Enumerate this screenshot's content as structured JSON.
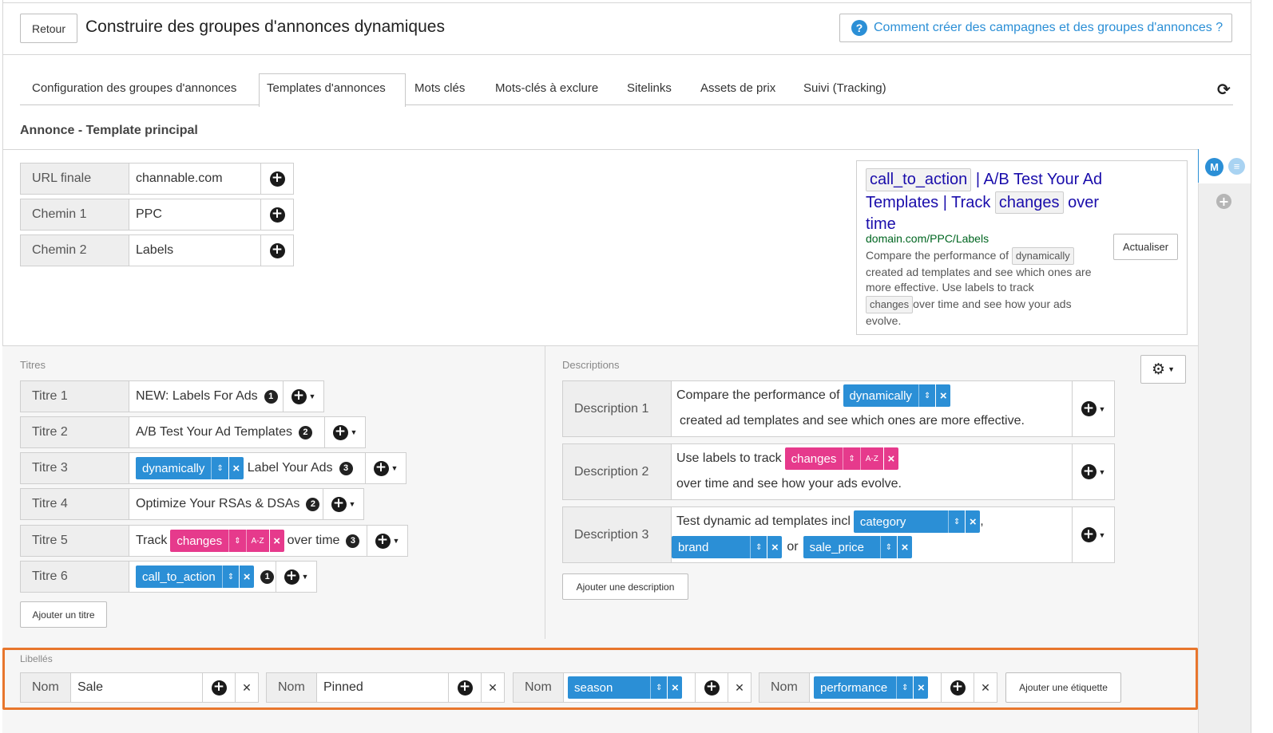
{
  "header": {
    "back_label": "Retour",
    "title": "Construire des groupes d'annonces dynamiques",
    "help_label": "Comment créer des campagnes et des groupes d'annonces ?",
    "help_icon": "?"
  },
  "tabs": [
    {
      "label": "Configuration des groupes d'annonces"
    },
    {
      "label": "Templates d'annonces",
      "active": true
    },
    {
      "label": "Mots clés"
    },
    {
      "label": "Mots-clés à exclure"
    },
    {
      "label": "Sitelinks"
    },
    {
      "label": "Assets de prix"
    },
    {
      "label": "Suivi (Tracking)"
    }
  ],
  "section_title": "Annonce - Template principal",
  "url_fields": [
    {
      "label": "URL finale",
      "value": "channable.com"
    },
    {
      "label": "Chemin 1",
      "value": "PPC"
    },
    {
      "label": "Chemin 2",
      "value": "Labels"
    }
  ],
  "preview": {
    "headline_tag1": "call_to_action",
    "headline_part1": "| A/B Test Your Ad",
    "headline_part2": "Templates | Track",
    "headline_tag2": "changes",
    "headline_part3": "over",
    "headline_part4": "time",
    "url": "domain.com/PPC/Labels",
    "desc1": "Compare the performance of",
    "desc_tag1": "dynamically",
    "desc2": "created ad templates and see which ones are",
    "desc3": "more effective.  Use labels to track",
    "desc_tag2": "changes",
    "desc4": "over time and see how your ads",
    "desc5": "evolve.",
    "refresh_label": "Actualiser"
  },
  "side_rail": {
    "avatar": "M"
  },
  "titles_section": {
    "label": "Titres",
    "add_label": "Ajouter un titre",
    "rows": [
      {
        "label": "Titre 1",
        "text": "NEW: Labels For Ads",
        "badge": "1"
      },
      {
        "label": "Titre 2",
        "text": "A/B Test Your Ad Templates",
        "badge": "2"
      },
      {
        "label": "Titre 3",
        "tag": "dynamically",
        "text": "Label Your Ads",
        "badge": "3"
      },
      {
        "label": "Titre 4",
        "text": "Optimize Your RSAs & DSAs",
        "badge": "2"
      },
      {
        "label": "Titre 5",
        "prefix": "Track",
        "tag": "changes",
        "tag_extra": "A-Z",
        "text": "over time",
        "badge": "3"
      },
      {
        "label": "Titre 6",
        "tag": "call_to_action",
        "badge": "1"
      }
    ]
  },
  "descriptions_section": {
    "label": "Descriptions",
    "add_label": "Ajouter une description",
    "rows": [
      {
        "label": "Description 1",
        "line1_text": "Compare the performance of",
        "line1_tag": "dynamically",
        "line2_text": "created ad templates and see which ones are more effective."
      },
      {
        "label": "Description 2",
        "line1_text": "Use labels to track",
        "line1_tag": "changes",
        "line1_tag_extra": "A-Z",
        "line2_text": "over time and see how your ads evolve."
      },
      {
        "label": "Description 3",
        "line1_text": "Test dynamic ad templates incl",
        "line1_tag": "category",
        "line1_after": ",",
        "line2_tag": "brand",
        "line2_mid": "or",
        "line2_tag2": "sale_price"
      }
    ]
  },
  "labels_section": {
    "label": "Libellés",
    "add_label": "Ajouter une étiquette",
    "items": [
      {
        "label": "Nom",
        "value": "Sale"
      },
      {
        "label": "Nom",
        "value": "Pinned"
      },
      {
        "label": "Nom",
        "tag": "season"
      },
      {
        "label": "Nom",
        "tag": "performance"
      }
    ]
  },
  "colors": {
    "tag_blue": "#2b8fd6",
    "tag_pink": "#e63a8c",
    "highlight_orange": "#e8762d",
    "ad_link_blue": "#1a0dab",
    "ad_url_green": "#006621"
  }
}
